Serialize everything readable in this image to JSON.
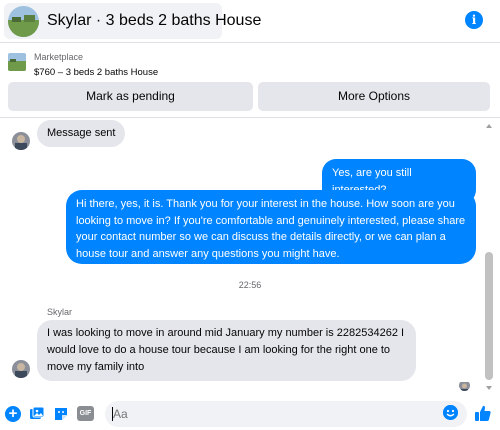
{
  "header": {
    "title": "Skylar · 3 beds 2 baths House",
    "info_icon": "info-icon",
    "info_glyph": "i"
  },
  "listing": {
    "label": "Marketplace",
    "price_title": "$760 – 3 beds 2 baths House"
  },
  "actions": {
    "mark_pending": "Mark as pending",
    "more_options": "More Options"
  },
  "messages": [
    {
      "from": "them",
      "text": "Message sent"
    },
    {
      "from": "me",
      "text": "Yes, are you still interested?"
    },
    {
      "from": "me",
      "text": "Hi there, yes, it is. Thank you for your interest in the house. How soon are you looking to move in? If you're comfortable and genuinely interested, please share your contact number so we can discuss the details directly, or we can plan a house tour and answer any questions you might have."
    },
    {
      "from": "them",
      "text": "I was looking to move in around mid January my number is 2282534262 I would love to do a house tour because I am looking for the right one to move my family into"
    }
  ],
  "timestamp": "22:56",
  "sender_name": "Skylar",
  "composer": {
    "placeholder": "Aa",
    "plus_glyph": "+",
    "gif_label": "GIF"
  },
  "colors": {
    "accent": "#0084ff",
    "incoming_bubble": "#e4e6eb",
    "button_bg": "#e4e6eb"
  }
}
